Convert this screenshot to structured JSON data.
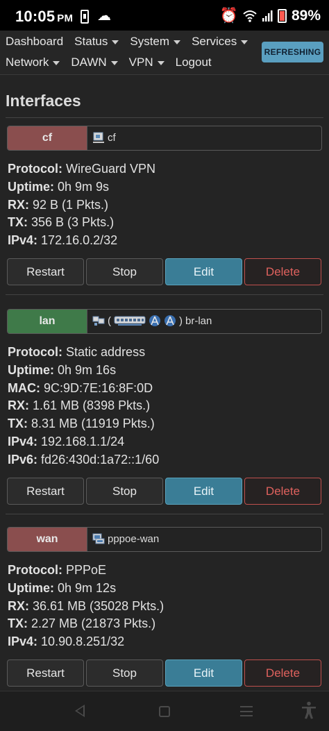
{
  "status_bar": {
    "time": "10:05",
    "ampm": "PM",
    "battery": "89%",
    "icons": [
      "phone-icon",
      "cloud-icon",
      "alarm-icon",
      "wifi-icon",
      "signal-icon",
      "battery-icon"
    ]
  },
  "nav": {
    "row1": [
      {
        "label": "Dashboard",
        "dropdown": false
      },
      {
        "label": "Status",
        "dropdown": true
      },
      {
        "label": "System",
        "dropdown": true
      },
      {
        "label": "Services",
        "dropdown": true
      }
    ],
    "row2": [
      {
        "label": "Network",
        "dropdown": true
      },
      {
        "label": "DAWN",
        "dropdown": true
      },
      {
        "label": "VPN",
        "dropdown": true
      },
      {
        "label": "Logout",
        "dropdown": false
      }
    ],
    "refresh_label": "REFRESHING"
  },
  "page": {
    "title": "Interfaces"
  },
  "interfaces": [
    {
      "name": "cf",
      "color": "#8a4e4e",
      "device": "cf",
      "device_prefix": "",
      "device_suffix": "",
      "details": [
        {
          "key": "Protocol:",
          "value": "WireGuard VPN"
        },
        {
          "key": "Uptime:",
          "value": "0h 9m 9s"
        },
        {
          "key": "RX:",
          "value": "92 B (1 Pkts.)"
        },
        {
          "key": "TX:",
          "value": "356 B (3 Pkts.)"
        },
        {
          "key": "IPv4:",
          "value": "172.16.0.2/32"
        }
      ]
    },
    {
      "name": "lan",
      "color": "#3f7a49",
      "device": "br-lan",
      "device_prefix": "(",
      "device_suffix": ")",
      "details": [
        {
          "key": "Protocol:",
          "value": "Static address"
        },
        {
          "key": "Uptime:",
          "value": "0h 9m 16s"
        },
        {
          "key": "MAC:",
          "value": "9C:9D:7E:16:8F:0D"
        },
        {
          "key": "RX:",
          "value": "1.61 MB (8398 Pkts.)"
        },
        {
          "key": "TX:",
          "value": "8.31 MB (11919 Pkts.)"
        },
        {
          "key": "IPv4:",
          "value": "192.168.1.1/24"
        },
        {
          "key": "IPv6:",
          "value": "fd26:430d:1a72::1/60"
        }
      ]
    },
    {
      "name": "wan",
      "color": "#8a4e4e",
      "device": "pppoe-wan",
      "device_prefix": "",
      "device_suffix": "",
      "details": [
        {
          "key": "Protocol:",
          "value": "PPPoE"
        },
        {
          "key": "Uptime:",
          "value": "0h 9m 12s"
        },
        {
          "key": "RX:",
          "value": "36.61 MB (35028 Pkts.)"
        },
        {
          "key": "TX:",
          "value": "2.27 MB (21873 Pkts.)"
        },
        {
          "key": "IPv4:",
          "value": "10.90.8.251/32"
        }
      ]
    }
  ],
  "buttons": {
    "restart": "Restart",
    "stop": "Stop",
    "edit": "Edit",
    "delete": "Delete"
  }
}
